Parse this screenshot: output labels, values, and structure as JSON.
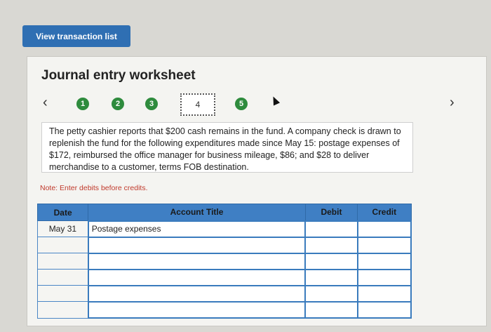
{
  "header": {
    "view_transactions_label": "View transaction list"
  },
  "worksheet": {
    "title": "Journal entry worksheet",
    "steps": [
      "1",
      "2",
      "3",
      "4",
      "5"
    ],
    "current_step": "4",
    "description": "The petty cashier reports that $200 cash remains in the fund. A company check is drawn to replenish the fund for the following expenditures made since May 15: postage expenses of $172, reimbursed the office manager for business mileage, $86; and $28 to deliver merchandise to a customer, terms FOB destination.",
    "note": "Note: Enter debits before credits."
  },
  "table": {
    "headers": {
      "date": "Date",
      "account": "Account Title",
      "debit": "Debit",
      "credit": "Credit"
    },
    "rows": [
      {
        "date": "May 31",
        "account": "Postage expenses",
        "debit": "",
        "credit": ""
      },
      {
        "date": "",
        "account": "",
        "debit": "",
        "credit": ""
      },
      {
        "date": "",
        "account": "",
        "debit": "",
        "credit": ""
      },
      {
        "date": "",
        "account": "",
        "debit": "",
        "credit": ""
      },
      {
        "date": "",
        "account": "",
        "debit": "",
        "credit": ""
      },
      {
        "date": "",
        "account": "",
        "debit": "",
        "credit": ""
      }
    ]
  },
  "colors": {
    "button_blue": "#2f6fb3",
    "step_green": "#2e8b3d",
    "header_blue": "#3f7fc4",
    "note_red": "#c0392b"
  }
}
